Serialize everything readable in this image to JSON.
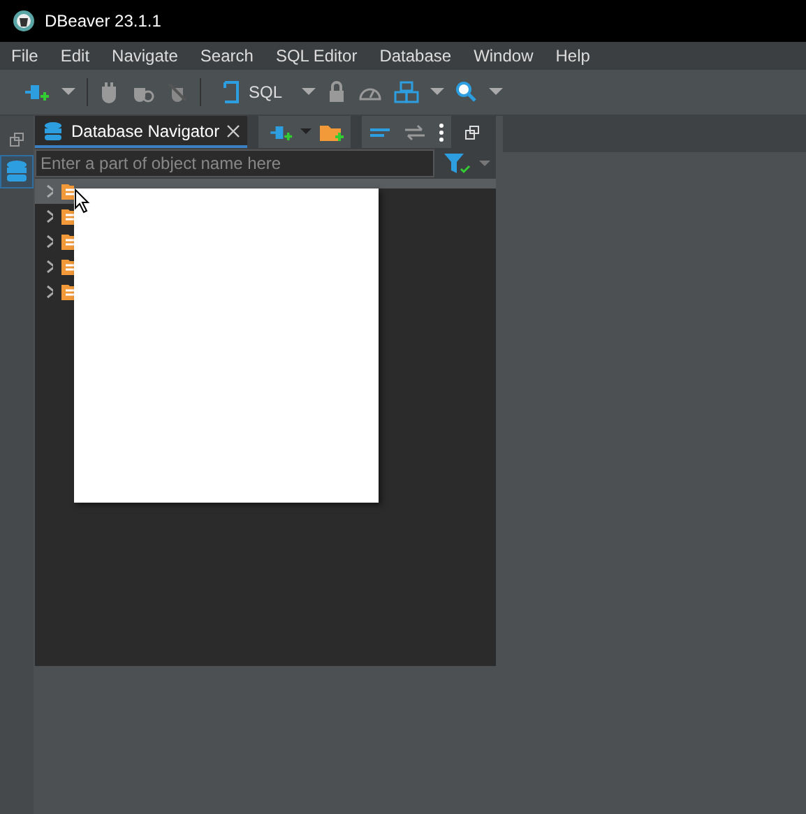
{
  "window": {
    "title": "DBeaver 23.1.1"
  },
  "menu": [
    "File",
    "Edit",
    "Navigate",
    "Search",
    "SQL Editor",
    "Database",
    "Window",
    "Help"
  ],
  "toolbar": {
    "sql_label": "SQL"
  },
  "navigator": {
    "tab": "Database Navigator",
    "search": {
      "placeholder": "Enter a part of object name here"
    },
    "items": [
      {
        "selected": true
      },
      {
        "selected": false
      },
      {
        "selected": false
      },
      {
        "selected": false
      },
      {
        "selected": false
      }
    ]
  }
}
